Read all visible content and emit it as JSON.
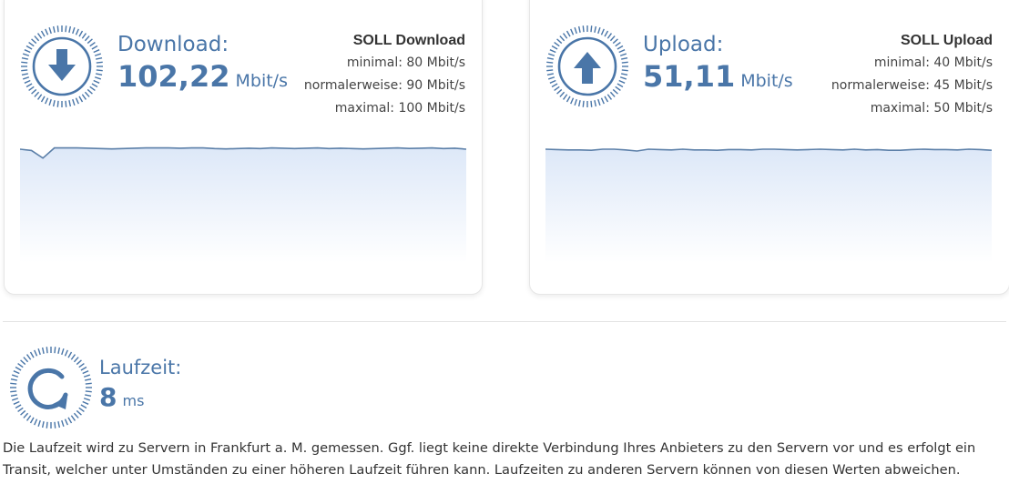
{
  "download": {
    "label": "Download:",
    "value": "102,22",
    "unit": "Mbit/s",
    "icon": "arrow-down-icon",
    "soll_title": "SOLL Download",
    "soll_min": "minimal: 80 Mbit/s",
    "soll_normal": "normalerweise: 90 Mbit/s",
    "soll_max": "maximal: 100 Mbit/s",
    "series": [
      101,
      100,
      94,
      102,
      102,
      102,
      101.8,
      101.5,
      101.2,
      101.5,
      101.8,
      102,
      102,
      102,
      101.8,
      102,
      102,
      101.5,
      101.2,
      101.5,
      101.8,
      101.5,
      102,
      101.8,
      101.5,
      101.8,
      102,
      101.5,
      101.8,
      101.5,
      101.2,
      101.5,
      101.8,
      102,
      101.6,
      101.8,
      102,
      101.5,
      101.8,
      101
    ]
  },
  "upload": {
    "label": "Upload:",
    "value": "51,11",
    "unit": "Mbit/s",
    "icon": "arrow-up-icon",
    "soll_title": "SOLL Upload",
    "soll_min": "minimal: 40 Mbit/s",
    "soll_normal": "normalerweise: 45 Mbit/s",
    "soll_max": "maximal: 50 Mbit/s",
    "series": [
      51.1,
      51.0,
      50.9,
      50.9,
      50.8,
      51.1,
      51.1,
      50.9,
      50.6,
      51.1,
      51.0,
      50.9,
      51.1,
      50.9,
      50.9,
      50.8,
      51.0,
      51.0,
      50.9,
      51.1,
      51.1,
      51.0,
      50.9,
      51.0,
      51.1,
      51.0,
      50.9,
      51.1,
      50.9,
      51.0,
      50.8,
      50.8,
      51.0,
      51.1,
      51.0,
      51.0,
      50.9,
      51.1,
      51.0,
      50.8
    ]
  },
  "latency": {
    "label": "Laufzeit:",
    "value": "8",
    "unit": "ms",
    "icon": "refresh-icon"
  },
  "note": "Die Laufzeit wird zu Servern in Frankfurt a. M. gemessen. Ggf. liegt keine direkte Verbindung Ihres Anbieters zu den Servern vor und es erfolgt ein Transit, welcher unter Umständen zu einer höheren Laufzeit führen kann. Laufzeiten zu anderen Servern können von diesen Werten abweichen.",
  "colors": {
    "accent": "#4a76a8",
    "line": "#5b7fa8",
    "fill_top": "#dde8f8"
  }
}
